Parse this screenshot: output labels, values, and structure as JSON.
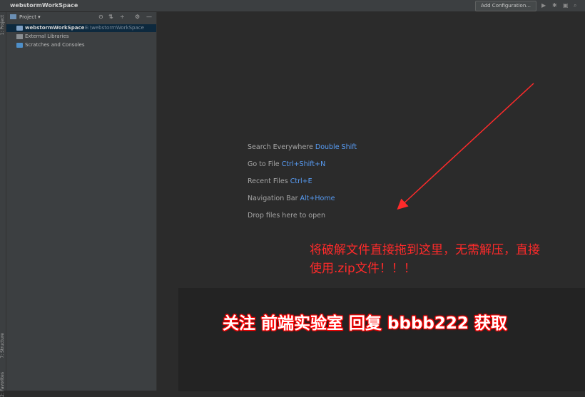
{
  "window": {
    "title": "webstormWorkSpace",
    "add_configuration_label": "Add Configuration...",
    "toolbar_icons": [
      "run-icon",
      "debug-icon",
      "coverage-icon",
      "search-everywhere-icon"
    ]
  },
  "left_strip": {
    "project_label": "1: Project",
    "structure_label": "7: Structure",
    "favorites_label": "2: Favorites"
  },
  "project_panel": {
    "title": "Project",
    "dropdown_icon": "chevron-down-icon",
    "tools": [
      "locate-icon",
      "collapse-icon",
      "expand-icon",
      "gear-icon",
      "minimize-icon"
    ],
    "tree": [
      {
        "label": "webstormWorkSpace",
        "path": "E:\\webstormWorkSpace",
        "icon": "folder-icon",
        "selected": true
      },
      {
        "label": "External Libraries",
        "icon": "library-icon"
      },
      {
        "label": "Scratches and Consoles",
        "icon": "scratches-icon"
      }
    ]
  },
  "editor": {
    "hints": [
      {
        "label": "Search Everywhere",
        "shortcut": "Double Shift"
      },
      {
        "label": "Go to File",
        "shortcut": "Ctrl+Shift+N"
      },
      {
        "label": "Recent Files",
        "shortcut": "Ctrl+E"
      },
      {
        "label": "Navigation Bar",
        "shortcut": "Alt+Home"
      },
      {
        "label": "Drop files here to open",
        "shortcut": ""
      }
    ]
  },
  "overlay": {
    "instruction_line1": "将破解文件直接拖到这里，无需解压，直接",
    "instruction_line2": "使用.zip文件！！！",
    "banner": "关注  前端实验室   回复 bbbb222 获取",
    "accent_color": "#ff2a2a"
  }
}
